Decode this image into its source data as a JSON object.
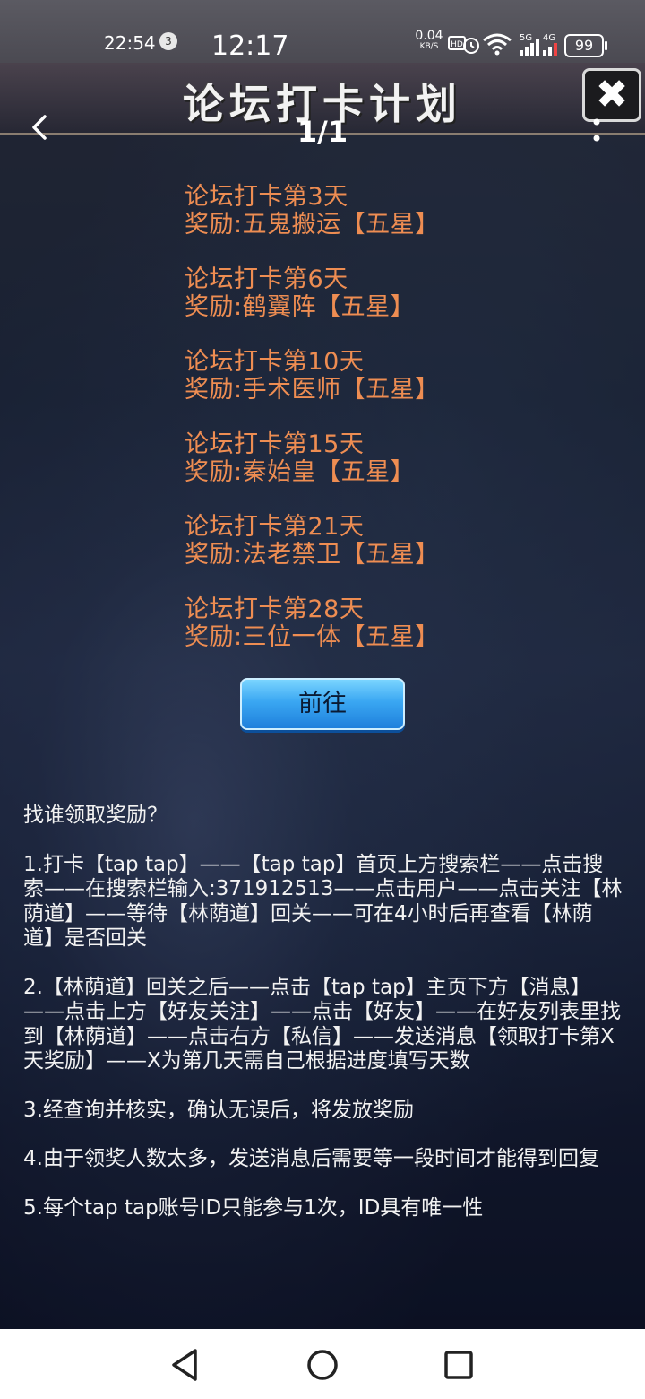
{
  "status_bar": {
    "time_small": "22:54",
    "notification_count": "3",
    "time_main": "12:17",
    "net_speed_value": "0.04",
    "net_speed_unit": "KB/S",
    "battery": "99"
  },
  "header": {
    "title": "论坛打卡计划",
    "page_indicator": "1/1"
  },
  "rewards": [
    {
      "day": "论坛打卡第3天",
      "reward": "奖励:五鬼搬运【五星】"
    },
    {
      "day": "论坛打卡第6天",
      "reward": "奖励:鹤翼阵【五星】"
    },
    {
      "day": "论坛打卡第10天",
      "reward": "奖励:手术医师【五星】"
    },
    {
      "day": "论坛打卡第15天",
      "reward": "奖励:秦始皇【五星】"
    },
    {
      "day": "论坛打卡第21天",
      "reward": "奖励:法老禁卫【五星】"
    },
    {
      "day": "论坛打卡第28天",
      "reward": "奖励:三位一体【五星】"
    }
  ],
  "go_button": "前往",
  "info": {
    "heading": "找谁领取奖励？",
    "steps": [
      "1.打卡【tap tap】——【tap tap】首页上方搜索栏——点击搜索——在搜索栏输入:371912513——点击用户——点击关注【林荫道】——等待【林荫道】回关——可在4小时后再查看【林荫道】是否回关",
      "2.【林荫道】回关之后——点击【tap tap】主页下方【消息】——点击上方【好友关注】——点击【好友】——在好友列表里找到【林荫道】——点击右方【私信】——发送消息【领取打卡第X天奖励】——X为第几天需自己根据进度填写天数",
      "3.经查询并核实，确认无误后，将发放奖励",
      "4.由于领奖人数太多，发送消息后需要等一段时间才能得到回复",
      "5.每个tap tap账号ID只能参与1次，ID具有唯一性"
    ]
  },
  "colors": {
    "reward_text": "#ee8d52",
    "button_blue": "#3aa7f2"
  },
  "icons": {
    "back": "chevron-left-icon",
    "close": "close-icon",
    "more": "more-vertical-icon",
    "nav_back": "triangle-back-icon",
    "nav_home": "circle-home-icon",
    "nav_recent": "square-recents-icon"
  }
}
